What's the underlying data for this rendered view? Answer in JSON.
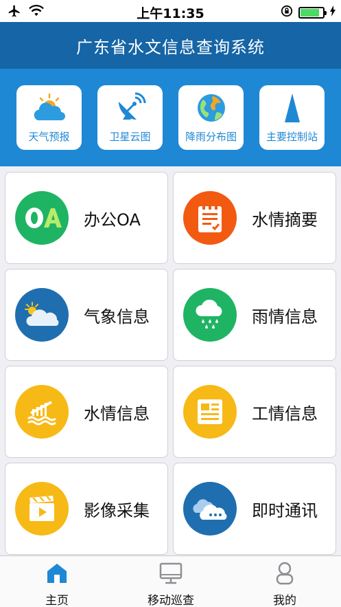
{
  "status_bar": {
    "time": "上午11:35"
  },
  "header": {
    "title": "广东省水文信息查询系统"
  },
  "quick_links": [
    {
      "label": "天气预报",
      "icon": "weather-sun-cloud-icon"
    },
    {
      "label": "卫星云图",
      "icon": "satellite-dish-icon"
    },
    {
      "label": "降雨分布图",
      "icon": "globe-icon"
    },
    {
      "label": "主要控制站",
      "icon": "triangle-marker-icon"
    }
  ],
  "tiles": [
    {
      "label": "办公OA",
      "icon": "oa-icon",
      "color": "#1fb463"
    },
    {
      "label": "水情摘要",
      "icon": "clipboard-icon",
      "color": "#f25a12"
    },
    {
      "label": "气象信息",
      "icon": "sun-cloud-icon",
      "color": "#1f6fb0"
    },
    {
      "label": "雨情信息",
      "icon": "rain-cloud-icon",
      "color": "#1fb463"
    },
    {
      "label": "水情信息",
      "icon": "water-level-icon",
      "color": "#f7b916"
    },
    {
      "label": "工情信息",
      "icon": "document-icon",
      "color": "#f7b916"
    },
    {
      "label": "影像采集",
      "icon": "video-clapper-icon",
      "color": "#f7b916"
    },
    {
      "label": "即时通讯",
      "icon": "chat-cloud-icon",
      "color": "#1f6fb0"
    }
  ],
  "tabs": [
    {
      "label": "主页",
      "icon": "home-icon",
      "active": true
    },
    {
      "label": "移动巡查",
      "icon": "monitor-icon",
      "active": false
    },
    {
      "label": "我的",
      "icon": "user-icon",
      "active": false
    }
  ],
  "colors": {
    "header": "#1665a6",
    "quickbar": "#1f88d4",
    "accent": "#1f88d4"
  }
}
